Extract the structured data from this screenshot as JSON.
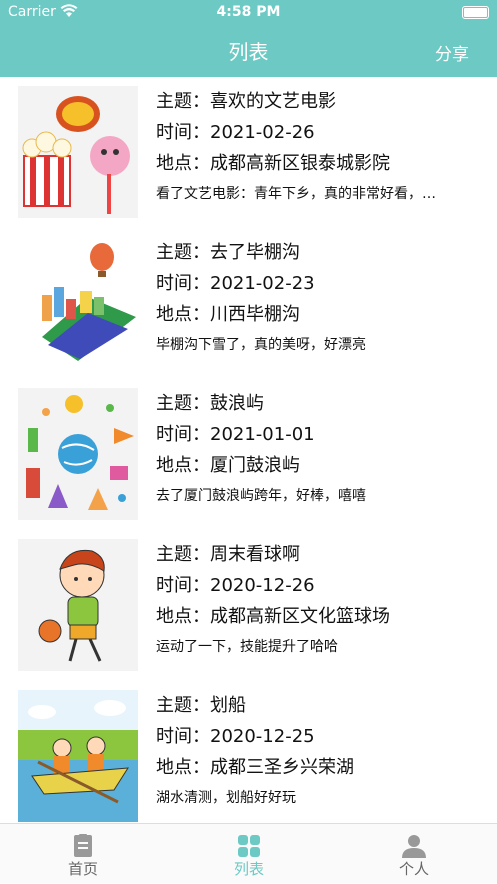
{
  "status_bar": {
    "carrier": "Carrier",
    "time": "4:58 PM"
  },
  "header": {
    "title": "列表",
    "share_label": "分享"
  },
  "items": [
    {
      "topic": "主题：喜欢的文艺电影",
      "time": "时间：2021-02-26",
      "place": "地点：成都高新区银泰城影院",
      "desc": "看了文艺电影：青年下乡，真的非常好看，…",
      "image_icon": "popcorn-icon"
    },
    {
      "topic": "主题：去了毕棚沟",
      "time": "时间：2021-02-23",
      "place": "地点：川西毕棚沟",
      "desc": "毕棚沟下雪了，真的美呀，好漂亮",
      "image_icon": "travel-city-icon"
    },
    {
      "topic": "主题：鼓浪屿",
      "time": "时间：2021-01-01",
      "place": "地点：厦门鼓浪屿",
      "desc": "去了厦门鼓浪屿跨年，好棒，嘻嘻",
      "image_icon": "globe-travel-icon"
    },
    {
      "topic": "主题：周末看球啊",
      "time": "时间：2020-12-26",
      "place": "地点：成都高新区文化篮球场",
      "desc": "运动了一下，技能提升了哈哈",
      "image_icon": "basketball-boy-icon"
    },
    {
      "topic": "主题：划船",
      "time": "时间：2020-12-25",
      "place": "地点：成都三圣乡兴荣湖",
      "desc": "湖水清测，划船好好玩",
      "image_icon": "rowing-boat-icon"
    }
  ],
  "tabbar": {
    "home": "首页",
    "list": "列表",
    "profile": "个人"
  },
  "colors": {
    "accent": "#6cc9c4",
    "inactive": "#666666"
  }
}
